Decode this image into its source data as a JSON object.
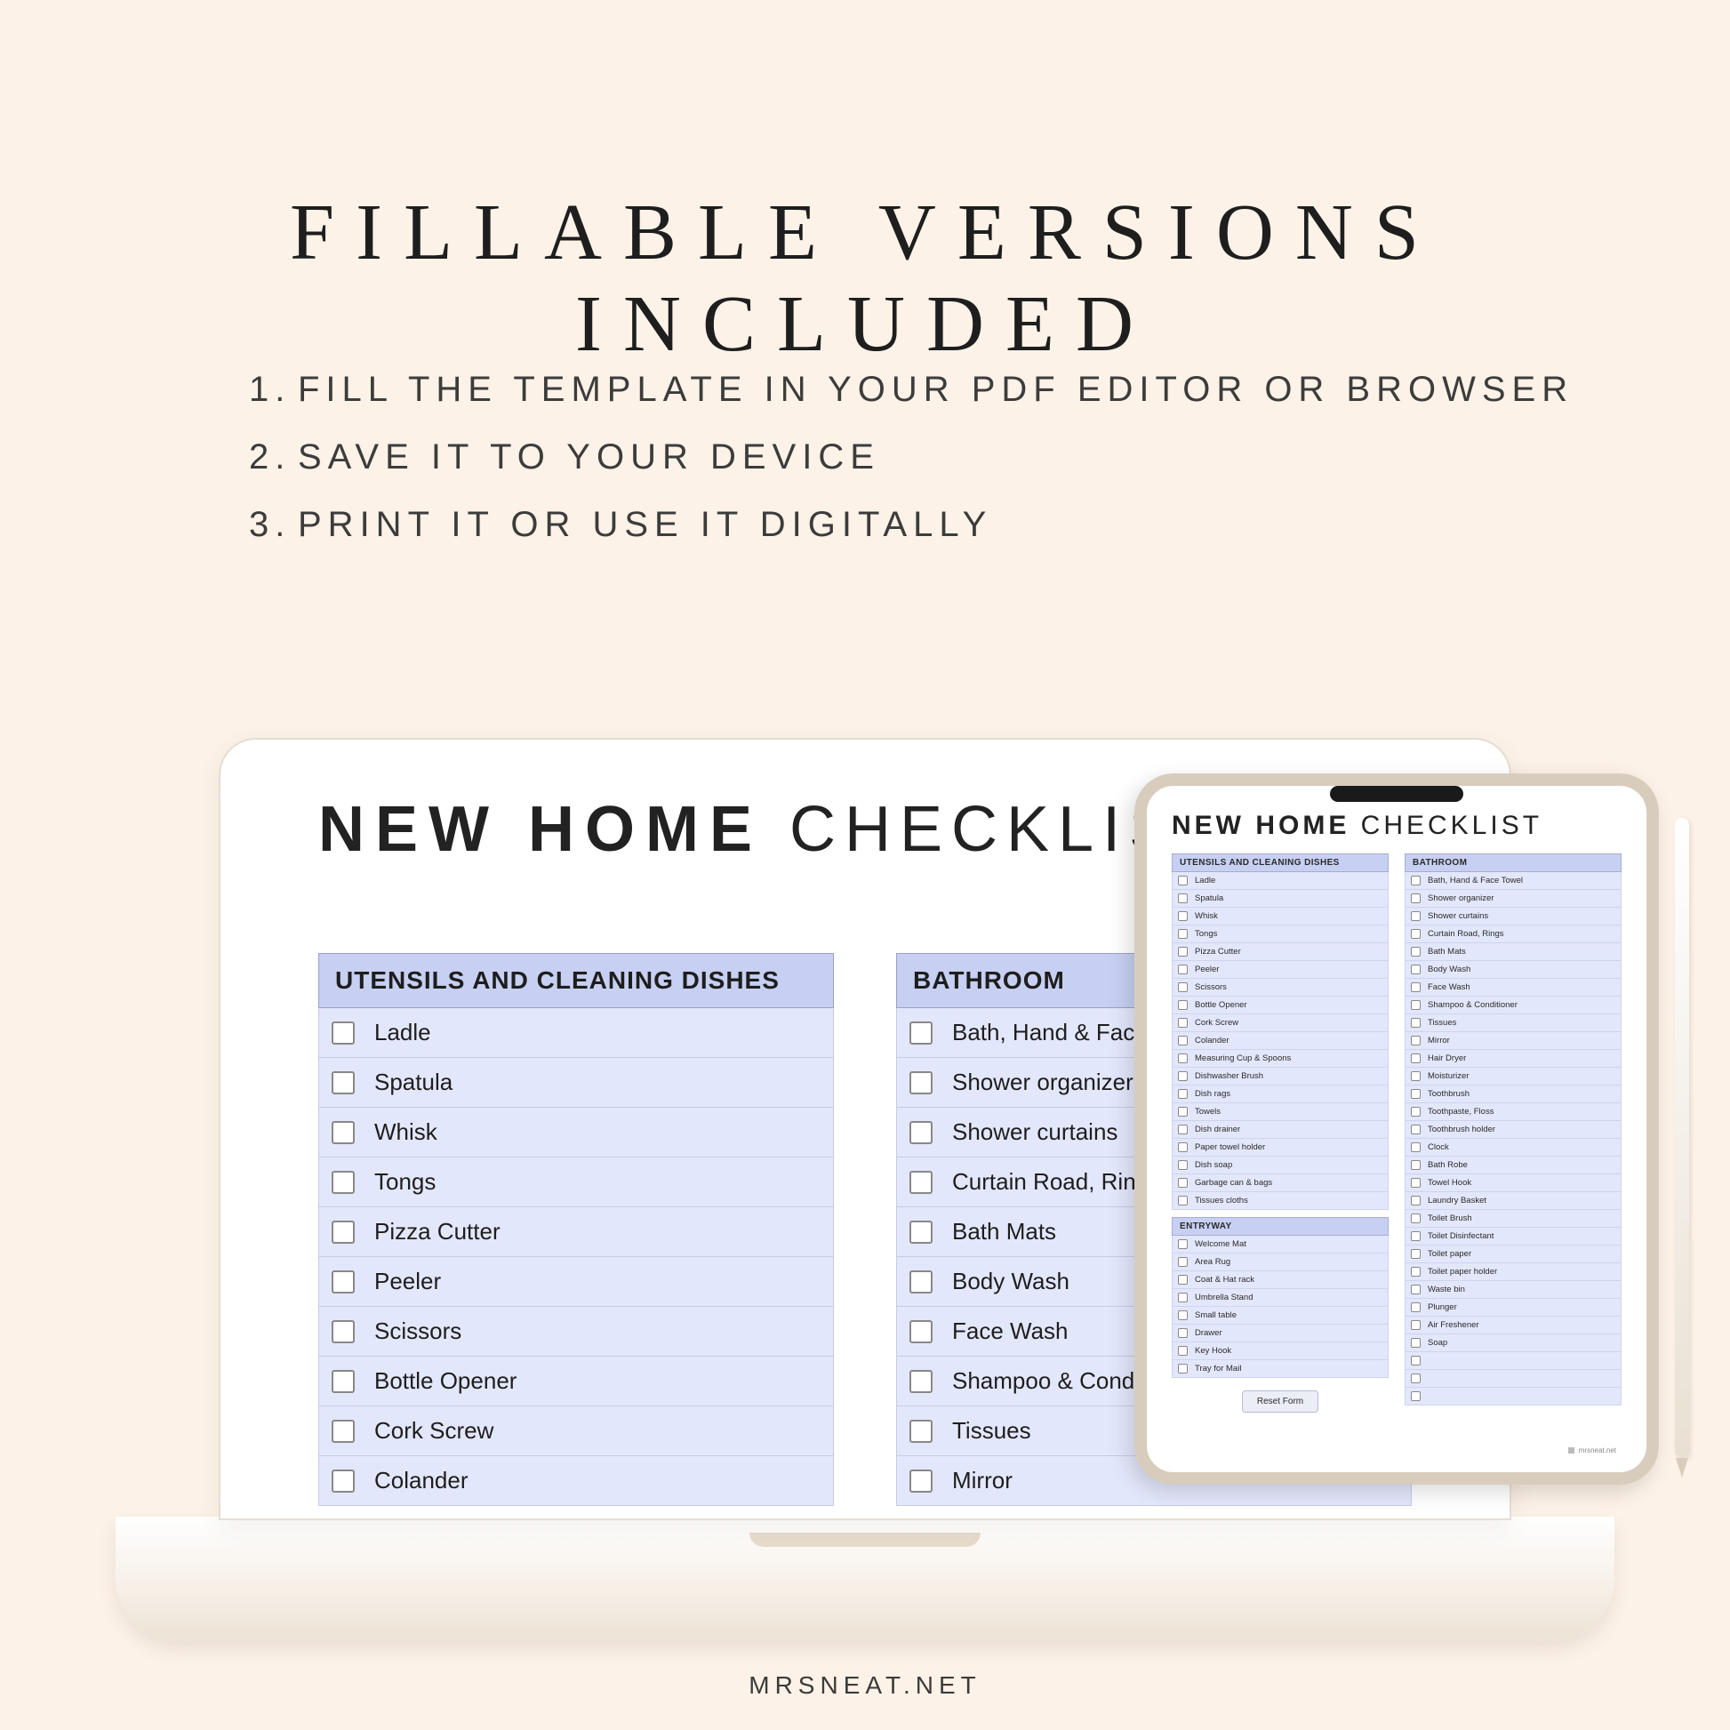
{
  "headline": "FILLABLE  VERSIONS  INCLUDED",
  "instructions": [
    "FILL THE TEMPLATE IN YOUR PDF EDITOR OR BROWSER",
    "SAVE IT TO YOUR DEVICE",
    "PRINT IT OR USE IT DIGITALLY"
  ],
  "document": {
    "title_bold": "NEW HOME",
    "title_light": "CHECKLIST",
    "left_header": "UTENSILS AND CLEANING DISHES",
    "right_header": "BATHROOM",
    "left_items": [
      "Ladle",
      "Spatula",
      "Whisk",
      "Tongs",
      "Pizza Cutter",
      "Peeler",
      "Scissors",
      "Bottle Opener",
      "Cork Screw",
      "Colander"
    ],
    "right_items": [
      "Bath, Hand & Face Towel",
      "Shower organizer",
      "Shower curtains",
      "Curtain Road, Rings",
      "Bath Mats",
      "Body Wash",
      "Face Wash",
      "Shampoo & Conditioner",
      "Tissues",
      "Mirror"
    ]
  },
  "tablet": {
    "title_bold": "NEW HOME",
    "title_light": "CHECKLIST",
    "col_a": {
      "header": "UTENSILS AND CLEANING DISHES",
      "items": [
        "Ladle",
        "Spatula",
        "Whisk",
        "Tongs",
        "Pizza Cutter",
        "Peeler",
        "Scissors",
        "Bottle Opener",
        "Cork Screw",
        "Colander",
        "Measuring Cup & Spoons",
        "Dishwasher Brush",
        "Dish rags",
        "Towels",
        "Dish drainer",
        "Paper towel holder",
        "Dish soap",
        "Garbage can & bags",
        "Tissues cloths"
      ]
    },
    "col_a2": {
      "header": "ENTRYWAY",
      "items": [
        "Welcome Mat",
        "Area Rug",
        "Coat & Hat rack",
        "Umbrella Stand",
        "Small table",
        "Drawer",
        "Key Hook",
        "Tray for Mail"
      ]
    },
    "col_b": {
      "header": "BATHROOM",
      "items": [
        "Bath, Hand & Face Towel",
        "Shower organizer",
        "Shower curtains",
        "Curtain Road, Rings",
        "Bath Mats",
        "Body Wash",
        "Face Wash",
        "Shampoo & Conditioner",
        "Tissues",
        "Mirror",
        "Hair Dryer",
        "Moisturizer",
        "Toothbrush",
        "Toothpaste, Floss",
        "Toothbrush holder",
        "Clock",
        "Bath Robe",
        "Towel Hook",
        "Laundry Basket",
        "Toilet Brush",
        "Toilet Disinfectant",
        "Toilet paper",
        "Toilet paper holder",
        "Waste bin",
        "Plunger",
        "Air Freshener",
        "Soap",
        "",
        "",
        ""
      ]
    },
    "button": "Reset Form",
    "footer": "mrsneat.net"
  },
  "footer": "MRSNEAT.NET"
}
